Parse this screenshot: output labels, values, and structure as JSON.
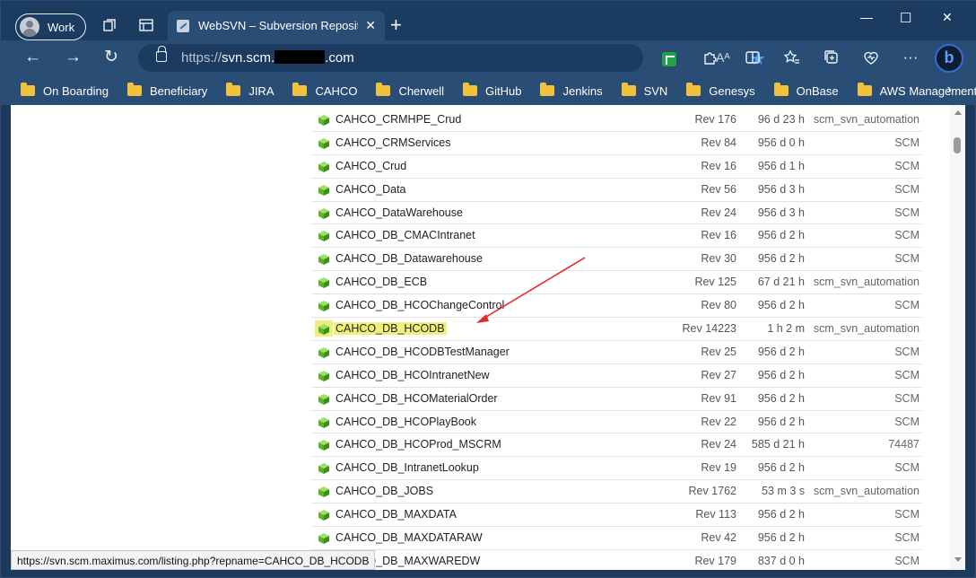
{
  "titlebar": {
    "profile_label": "Work",
    "tab_title": "WebSVN – Subversion Repositori",
    "new_tab": "+",
    "tab_close": "✕",
    "win_min": "—",
    "win_max": "☐",
    "win_close": "✕"
  },
  "toolbar": {
    "url_scheme": "https://",
    "url_host_start": "svn.scm.",
    "url_host_end": ".com",
    "read_aloud": "A)",
    "more": "···"
  },
  "bookmarks": [
    "On Boarding",
    "Beneficiary",
    "JIRA",
    "CAHCO",
    "Cherwell",
    "GitHub",
    "Jenkins",
    "SVN",
    "Genesys",
    "OnBase",
    "AWS Management..."
  ],
  "repos": [
    {
      "name": "CAHCO_CRMHPE_Crud",
      "rev": "Rev 176",
      "age": "96 d 23 h",
      "author": "scm_svn_automation"
    },
    {
      "name": "CAHCO_CRMServices",
      "rev": "Rev 84",
      "age": "956 d 0 h",
      "author": "SCM"
    },
    {
      "name": "CAHCO_Crud",
      "rev": "Rev 16",
      "age": "956 d 1 h",
      "author": "SCM"
    },
    {
      "name": "CAHCO_Data",
      "rev": "Rev 56",
      "age": "956 d 3 h",
      "author": "SCM"
    },
    {
      "name": "CAHCO_DataWarehouse",
      "rev": "Rev 24",
      "age": "956 d 3 h",
      "author": "SCM"
    },
    {
      "name": "CAHCO_DB_CMACIntranet",
      "rev": "Rev 16",
      "age": "956 d 2 h",
      "author": "SCM"
    },
    {
      "name": "CAHCO_DB_Datawarehouse",
      "rev": "Rev 30",
      "age": "956 d 2 h",
      "author": "SCM"
    },
    {
      "name": "CAHCO_DB_ECB",
      "rev": "Rev 125",
      "age": "67 d 21 h",
      "author": "scm_svn_automation"
    },
    {
      "name": "CAHCO_DB_HCOChangeControl",
      "rev": "Rev 80",
      "age": "956 d 2 h",
      "author": "SCM"
    },
    {
      "name": "CAHCO_DB_HCODB",
      "rev": "Rev 14223",
      "age": "1 h 2 m",
      "author": "scm_svn_automation",
      "highlighted": true
    },
    {
      "name": "CAHCO_DB_HCODBTestManager",
      "rev": "Rev 25",
      "age": "956 d 2 h",
      "author": "SCM"
    },
    {
      "name": "CAHCO_DB_HCOIntranetNew",
      "rev": "Rev 27",
      "age": "956 d 2 h",
      "author": "SCM"
    },
    {
      "name": "CAHCO_DB_HCOMaterialOrder",
      "rev": "Rev 91",
      "age": "956 d 2 h",
      "author": "SCM"
    },
    {
      "name": "CAHCO_DB_HCOPlayBook",
      "rev": "Rev 22",
      "age": "956 d 2 h",
      "author": "SCM"
    },
    {
      "name": "CAHCO_DB_HCOProd_MSCRM",
      "rev": "Rev 24",
      "age": "585 d 21 h",
      "author": "74487"
    },
    {
      "name": "CAHCO_DB_IntranetLookup",
      "rev": "Rev 19",
      "age": "956 d 2 h",
      "author": "SCM"
    },
    {
      "name": "CAHCO_DB_JOBS",
      "rev": "Rev 1762",
      "age": "53 m 3 s",
      "author": "scm_svn_automation"
    },
    {
      "name": "CAHCO_DB_MAXDATA",
      "rev": "Rev 113",
      "age": "956 d 2 h",
      "author": "SCM"
    },
    {
      "name": "CAHCO_DB_MAXDATARAW",
      "rev": "Rev 42",
      "age": "956 d 2 h",
      "author": "SCM"
    },
    {
      "name": "CAHCO_DB_MAXWAREDW",
      "rev": "Rev 179",
      "age": "837 d 0 h",
      "author": "SCM"
    }
  ],
  "status_url": "https://svn.scm.maximus.com/listing.php?repname=CAHCO_DB_HCODB",
  "colors": {
    "highlight": "#f2ee7c",
    "annotation_arrow": "#e0292b",
    "frame": "#2a4d76"
  }
}
